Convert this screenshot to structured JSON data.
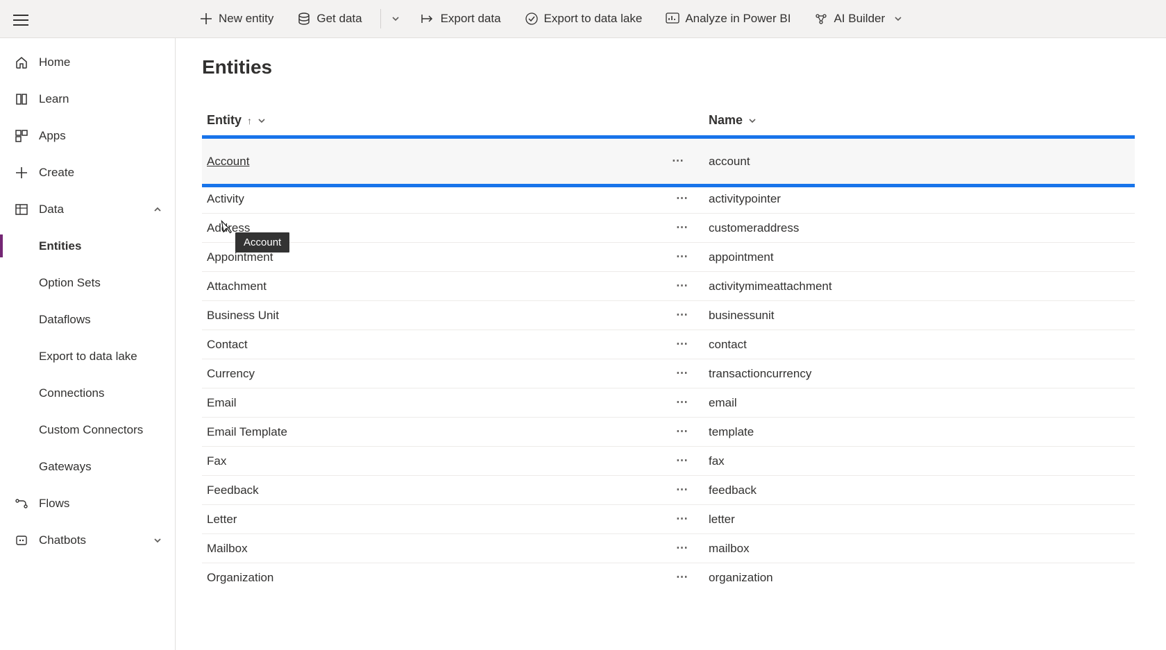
{
  "commandBar": {
    "newEntity": "New entity",
    "getData": "Get data",
    "exportData": "Export data",
    "exportLake": "Export to data lake",
    "analyze": "Analyze in Power BI",
    "aiBuilder": "AI Builder"
  },
  "sidebar": {
    "home": "Home",
    "learn": "Learn",
    "apps": "Apps",
    "create": "Create",
    "data": "Data",
    "dataSub": {
      "entities": "Entities",
      "optionSets": "Option Sets",
      "dataflows": "Dataflows",
      "exportLake": "Export to data lake",
      "connections": "Connections",
      "customConnectors": "Custom Connectors",
      "gateways": "Gateways"
    },
    "flows": "Flows",
    "chatbots": "Chatbots"
  },
  "page": {
    "title": "Entities",
    "cols": {
      "entity": "Entity",
      "name": "Name"
    },
    "tooltip": "Account",
    "rows": [
      {
        "entity": "Account",
        "name": "account",
        "highlight": true
      },
      {
        "entity": "Activity",
        "name": "activitypointer"
      },
      {
        "entity": "Address",
        "name": "customeraddress"
      },
      {
        "entity": "Appointment",
        "name": "appointment"
      },
      {
        "entity": "Attachment",
        "name": "activitymimeattachment"
      },
      {
        "entity": "Business Unit",
        "name": "businessunit"
      },
      {
        "entity": "Contact",
        "name": "contact"
      },
      {
        "entity": "Currency",
        "name": "transactioncurrency"
      },
      {
        "entity": "Email",
        "name": "email"
      },
      {
        "entity": "Email Template",
        "name": "template"
      },
      {
        "entity": "Fax",
        "name": "fax"
      },
      {
        "entity": "Feedback",
        "name": "feedback"
      },
      {
        "entity": "Letter",
        "name": "letter"
      },
      {
        "entity": "Mailbox",
        "name": "mailbox"
      },
      {
        "entity": "Organization",
        "name": "organization"
      }
    ]
  }
}
